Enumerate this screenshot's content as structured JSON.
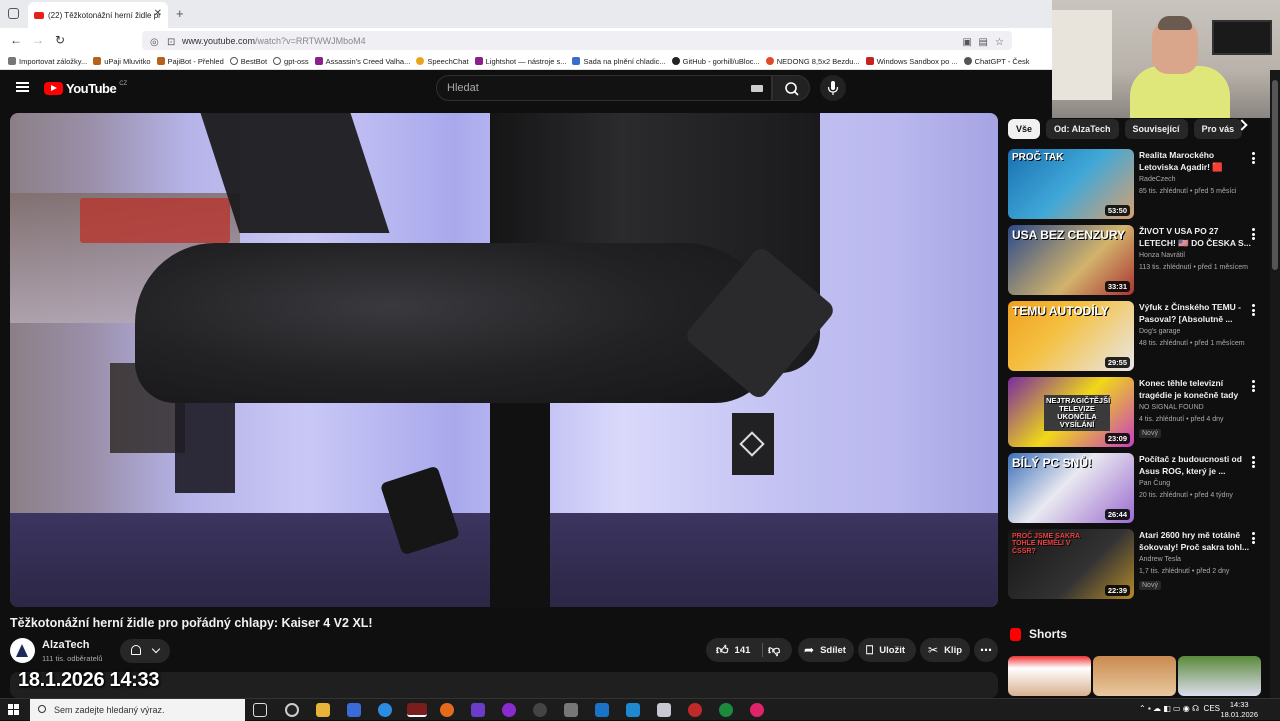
{
  "browser": {
    "tab_title": "(22) Těžkotonážní herní židle pr",
    "url_host": "www.youtube.com",
    "url_path": "/watch?v=RRTWWJMboM4",
    "bookmarks": [
      "Importovat záložky...",
      "uPaji Mluvitko",
      "PajiBot - Přehled",
      "BestBot",
      "gpt-oss",
      "Assassin's Creed Valha...",
      "SpeechChat",
      "Lightshot — nástroje s...",
      "Sada na plnění chladic...",
      "GitHub - gorhill/uBloc...",
      "NEDONG 8,5x2 Bezdu...",
      "Windows Sandbox po ...",
      "ChatGPT - Česk"
    ]
  },
  "header": {
    "logo_text": "YouTube",
    "region": "CZ",
    "search_placeholder": "Hledat"
  },
  "video": {
    "title": "Těžkotonážní herní židle pro pořádný chlapy: Kaiser 4 V2 XL!",
    "channel": "AlzaTech",
    "subscribers": "111 tis. odběratelů",
    "likes": "141",
    "share_label": "Sdílet",
    "save_label": "Uložit",
    "clip_label": "Klip"
  },
  "overlay": {
    "datetime": "18.1.2026 14:33"
  },
  "sidebar": {
    "chips": [
      "Vše",
      "Od: AlzaTech",
      "Související",
      "Pro vás"
    ],
    "recommendations": [
      {
        "title": "Realita Marockého Letoviska Agadir! 🟥",
        "channel": "RadeCzech",
        "meta": "85 tis. zhlédnutí • před 5 měsíci",
        "duration": "53:50",
        "thumb_text": "PROČ TAK",
        "badge": ""
      },
      {
        "title": "ŽIVOT V USA PO 27 LETECH! 🇺🇸 DO ČESKA S...",
        "channel": "Honza Navrátil",
        "meta": "113 tis. zhlédnutí • před 1 měsícem",
        "duration": "33:31",
        "thumb_text": "USA BEZ CENZURY",
        "badge": ""
      },
      {
        "title": "Výfuk z Čínského TEMU - Pasoval? [Absolutně ...",
        "channel": "Dog's garage",
        "meta": "48 tis. zhlédnutí • před 1 měsícem",
        "duration": "29:55",
        "thumb_text": "TEMU AUTODÍLY",
        "badge": ""
      },
      {
        "title": "Konec těhle televizní tragédie je konečně tady",
        "channel": "NO SIGNAL FOUND",
        "meta": "4 tis. zhlédnutí • před 4 dny",
        "duration": "23:09",
        "thumb_text": "NEJTRAGIČTĚJŠÍ TELEVIZE UKONČILA VYSÍLÁNÍ",
        "badge": "Nový"
      },
      {
        "title": "Počítač z budoucnosti od Asus ROG, který je ...",
        "channel": "Pan Čung",
        "meta": "20 tis. zhlédnutí • před 4 týdny",
        "duration": "26:44",
        "thumb_text": "BÍLÝ PC SNŮ!",
        "badge": ""
      },
      {
        "title": "Atari 2600 hry mě totálně šokovaly! Proč sakra tohl...",
        "channel": "Andrew Tesla",
        "meta": "1,7 tis. zhlédnutí • před 2 dny",
        "duration": "22:39",
        "thumb_text": "PROČ JSME SAKRA TOHLE NEMĚLI V ČSSR?",
        "badge": "Nový"
      }
    ],
    "shorts_label": "Shorts"
  },
  "taskbar": {
    "search_placeholder": "Sem zadejte hledaný výraz.",
    "language": "CES",
    "time": "14:33",
    "date": "18.01.2026"
  }
}
